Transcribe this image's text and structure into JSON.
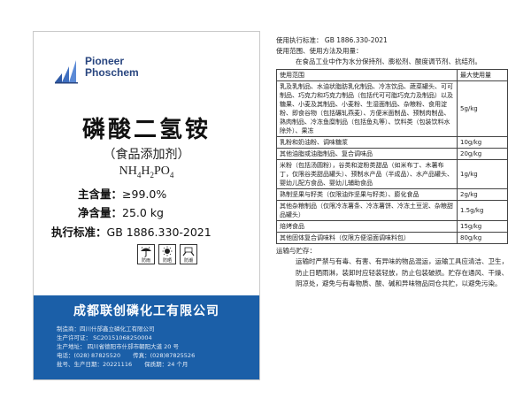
{
  "bag": {
    "logo_line1": "Pioneer",
    "logo_line2": "Phoschem",
    "product_name": "磷酸二氢铵",
    "category": "（食品添加剂）",
    "formula": {
      "a": "NH",
      "s1": "4",
      "b": "H",
      "s2": "2",
      "c": "PO",
      "s3": "4"
    },
    "content_label": "主含量：",
    "content_value": "≥99.0%",
    "net_label": "净含量：",
    "net_value": "25.0 kg",
    "std_label": "执行标准：",
    "std_value": "GB 1886.330-2021",
    "pictograms": [
      {
        "icon": "umbrella-icon",
        "caption": "防雨"
      },
      {
        "icon": "sun-icon",
        "caption": "防晒"
      },
      {
        "icon": "hands-icon",
        "caption": "防潮"
      }
    ],
    "company": "成都联创磷化工有限公司",
    "info": {
      "maker": "制造商：四川什邡鑫立磷化工有限公司",
      "license": "生产许可证：  SC20151068250004",
      "address": "生产地址：  四川省德阳市什邡市朝阳大道 20 号",
      "phone": "电话：(028) 87825520",
      "fax": "传真：(028)87825526",
      "batch": "批号、生产日期：20221116",
      "shelf": "保质期：24 个月"
    }
  },
  "spec": {
    "standard": "使用执行标准：   GB 1886.330-2021",
    "scope_title": "使用范围、使用方法及用量：",
    "scope_desc": "在食品工业中作为水分保持剂、膨松剂、酸度调节剂、抗结剂。",
    "table_header": [
      "使用范围",
      "最大使用量"
    ],
    "table_rows": [
      [
        "乳及乳制品、水油状脂肪乳化制品、冷冻饮品、蔬菜罐头、可可制品、巧克力和巧克力制品（包括代可可脂巧克力及制品）以及糖果、小麦及其制品、小麦粉、生湿面制品、杂粮粉、食用淀粉、即食谷物（包括碾轧燕麦）、方便米面制品、预制肉制品、熟肉制品、冷冻鱼糜制品（包括鱼丸等）、饮料类（包装饮料水除外）、果冻",
        "5g/kg"
      ],
      [
        "乳粉和奶油粉、调味糖浆",
        "10g/kg"
      ],
      [
        "其他油脂或油脂制品、复合调味品",
        "20g/kg"
      ],
      [
        "米粉（包括汤圆粉），谷类和淀粉类甜品（如米布丁、木薯布丁，仅限谷类甜品罐头）、预制水产品（半成品）、水产品罐头、婴幼儿配方食品、婴幼儿辅助食品",
        "1g/kg"
      ],
      [
        "熟制坚果与籽类（仅限油炸坚果与籽类）、膨化食品",
        "2g/kg"
      ],
      [
        "其他杂粮制品（仅限冷冻薯条、冷冻薯饼、冷冻土豆泥、杂粮甜品罐头）",
        "1.5g/kg"
      ],
      [
        "焙烤食品",
        "15g/kg"
      ],
      [
        "其他固体复合调味料（仅限方便湿面调味料包）",
        "80g/kg"
      ]
    ],
    "storage_title": "运输与贮存：",
    "storage_text": "运输时严禁与有毒、有害、有异味的物品混运，运输工具应清洁、卫生，防止日晒雨淋，装卸时应轻装轻放，防止包装破损。贮存在通风、干燥、阴凉处，避免与有毒物质、酸、碱和异味物品同仓共贮，以避免污染。"
  }
}
